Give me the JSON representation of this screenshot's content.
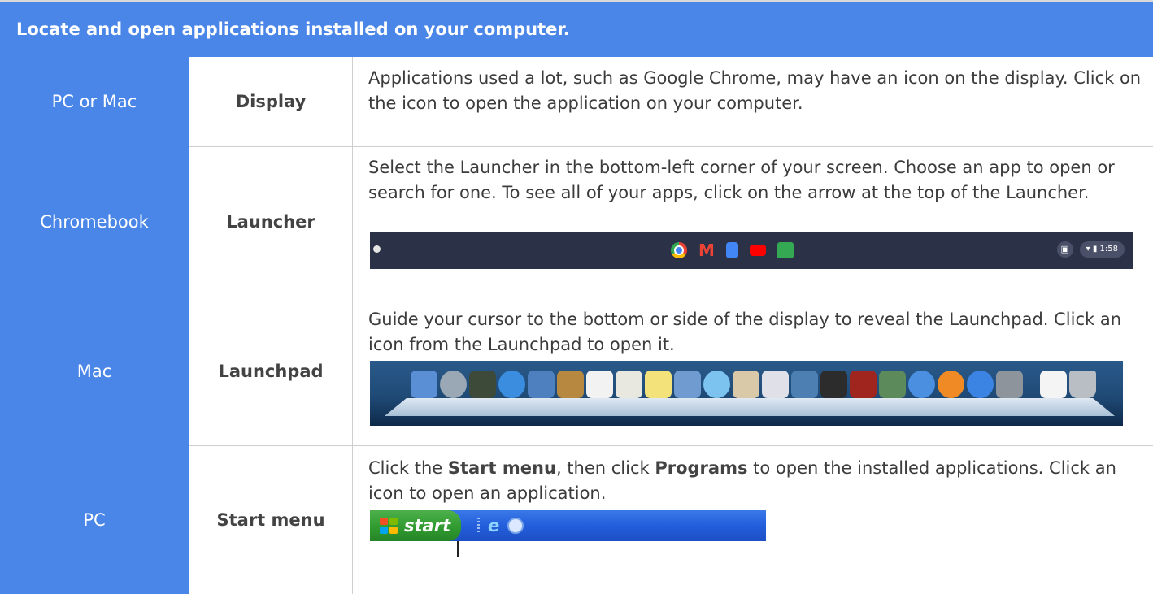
{
  "header": {
    "title": "Locate and open applications installed on your computer."
  },
  "rows": [
    {
      "platform": "PC or Mac",
      "method": "Display",
      "description": "Applications used a lot, such as Google Chrome, may have an icon on the display. Click on the icon to open the application on your computer."
    },
    {
      "platform": "Chromebook",
      "method": "Launcher",
      "description": "Select the Launcher in the bottom-left corner of your screen. Choose an app to open or search for one. To see all of your apps, click on the arrow at the top of the Launcher.",
      "screenshot": {
        "apps": [
          "chrome-icon",
          "gmail-icon",
          "docs-icon",
          "youtube-icon",
          "chat-icon"
        ],
        "tray_time": "1:58"
      }
    },
    {
      "platform": "Mac",
      "method": "Launchpad",
      "description": "Guide your cursor to the bottom or side of the display to reveal the Launchpad. Click an icon from the Launchpad to open it."
    },
    {
      "platform": "PC",
      "method": "Start menu",
      "description_parts": {
        "before_start": "Click the ",
        "start": "Start menu",
        "middle": ", then click ",
        "programs": "Programs",
        "after": " to open the installed applications. Click an icon to open an application."
      },
      "screenshot": {
        "start_label": "start"
      }
    }
  ],
  "colors": {
    "accent": "#4a86e8",
    "border": "#cfcfcf",
    "text": "#3c3c3c"
  }
}
